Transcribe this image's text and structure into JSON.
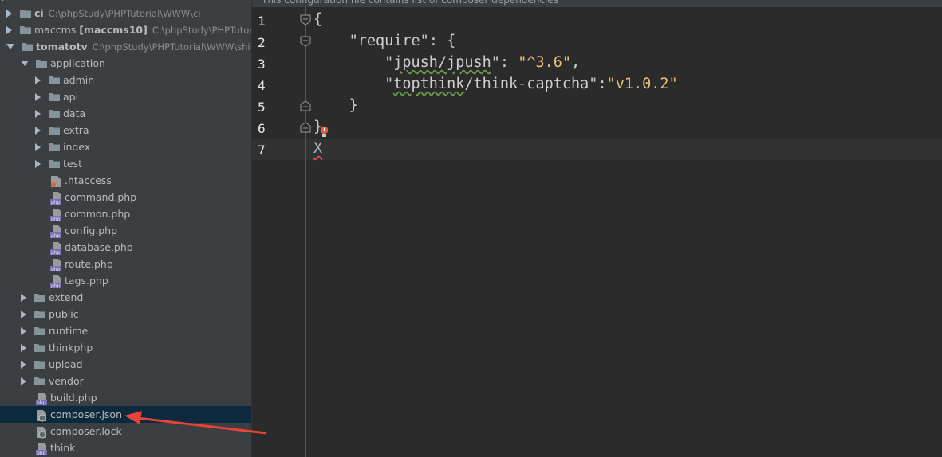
{
  "tree": {
    "projects": [
      {
        "name": "ci",
        "path": "C:\\phpStudy\\PHPTutorial\\WWW\\ci",
        "module": ""
      },
      {
        "name": "maccms",
        "path": "C:\\phpStudy\\PHPTutoria",
        "module": "[maccms10]"
      },
      {
        "name": "tomatotv",
        "path": "C:\\phpStudy\\PHPTutorial\\WWW\\shi"
      }
    ],
    "application_label": "application",
    "app_folders": [
      "admin",
      "api",
      "data",
      "extra",
      "index",
      "test"
    ],
    "app_files": [
      ".htaccess",
      "command.php",
      "common.php",
      "config.php",
      "database.php",
      "route.php",
      "tags.php"
    ],
    "root_folders": [
      "extend",
      "public",
      "runtime",
      "thinkphp",
      "upload",
      "vendor"
    ],
    "root_files": [
      "build.php",
      "composer.json",
      "composer.lock",
      "think"
    ]
  },
  "editor": {
    "banner": "This configuration file contains list of composer dependencies",
    "line_numbers": [
      "1",
      "2",
      "3",
      "4",
      "5",
      "6",
      "7"
    ],
    "lines": {
      "l1": "{",
      "l2_key": "\"require\"",
      "l2_rest": ": {",
      "l3_q1": "\"",
      "l3_pkg": "jpush/jpush",
      "l3_q2": "\"",
      "l3_colon": ": ",
      "l3_val": "\"^3.6\"",
      "l3_comma": ",",
      "l4_q1": "\"",
      "l4_pkg": "topthink",
      "l4_rest": "/think-captcha\"",
      "l4_colon": ":",
      "l4_val": "\"v1.0.2\"",
      "l5": "}",
      "l6": "}",
      "l7": "X"
    }
  },
  "colors": {
    "tree_bg": "#3c3f41",
    "editor_bg": "#2b2b2b",
    "selection": "#0d293e",
    "string": "#e6c07b",
    "annotation_arrow": "#e8423a"
  }
}
